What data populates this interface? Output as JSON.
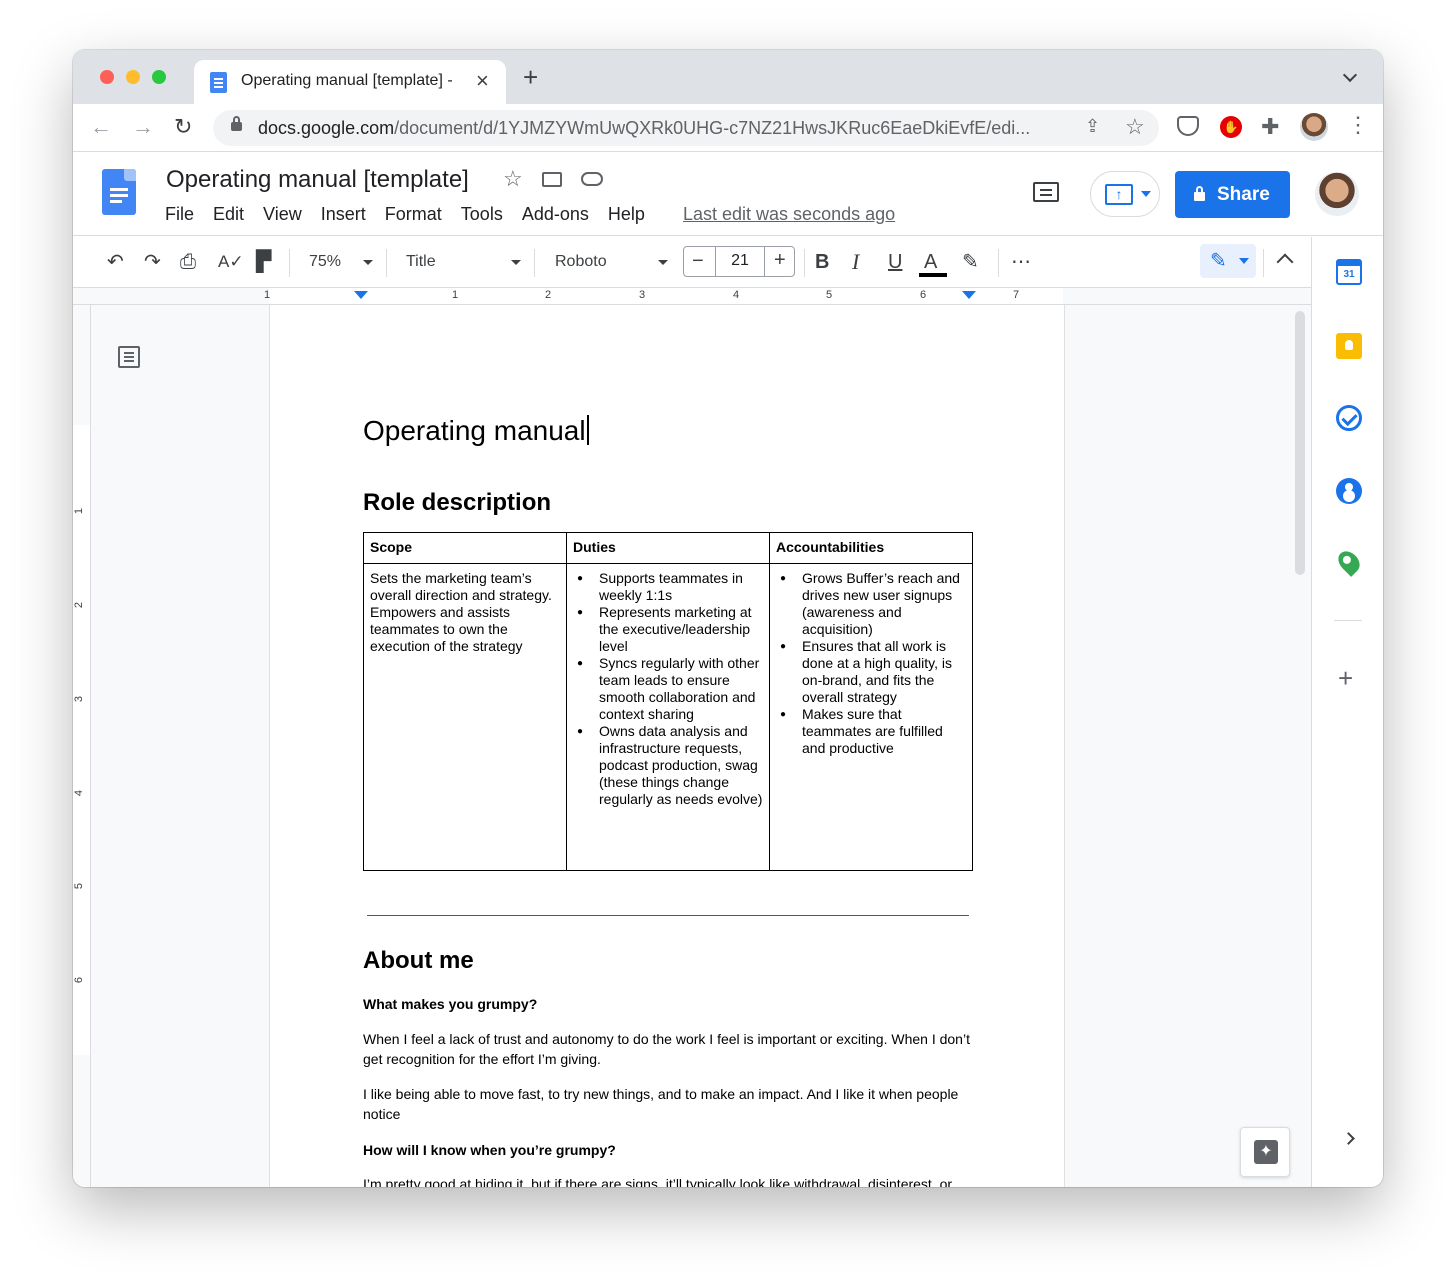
{
  "browser": {
    "tab_title": "Operating manual [template] -",
    "new_tab": "+",
    "url_host": "docs.google.com",
    "url_path": "/document/d/1YJMZYWmUwQXRk0UHG-c7NZ21HwsJKRuc6EaeDkiEvfE/edi..."
  },
  "docs": {
    "title": "Operating manual [template]",
    "menu": [
      "File",
      "Edit",
      "View",
      "Insert",
      "Format",
      "Tools",
      "Add-ons",
      "Help"
    ],
    "last_edit": "Last edit was seconds ago",
    "share_label": "Share"
  },
  "toolbar": {
    "zoom": "75%",
    "style": "Title",
    "font": "Roboto",
    "font_size": "21",
    "bold": "B",
    "italic": "I",
    "underline": "U",
    "text_color": "A"
  },
  "ruler": {
    "horizontal_labels": [
      "1",
      "1",
      "2",
      "3",
      "4",
      "5",
      "6",
      "7"
    ],
    "vertical_labels": [
      "1",
      "2",
      "3",
      "4",
      "5",
      "6"
    ]
  },
  "document": {
    "title": "Operating manual",
    "role_heading": "Role description",
    "table": {
      "headers": [
        "Scope",
        "Duties",
        "Accountabilities"
      ],
      "scope": "Sets the marketing team’s overall direction and strategy. Empowers and assists teammates to own the execution of the strategy",
      "duties": [
        "Supports teammates in weekly 1:1s",
        "Represents marketing at the executive/leadership level",
        "Syncs regularly with other team leads to ensure smooth collaboration and context sharing",
        "Owns data analysis and infrastructure requests, podcast production, swag (these things change regularly as needs evolve)"
      ],
      "accountabilities": [
        "Grows Buffer’s reach and drives new user signups (awareness and acquisition)",
        "Ensures that all work is done at a high quality, is on-brand, and fits the overall strategy",
        "Makes sure that teammates are fulfilled and productive"
      ]
    },
    "about_heading": "About me",
    "q1": "What makes you grumpy?",
    "p1": "When I feel a lack of trust and autonomy to do the work I feel is important or exciting. When I don’t get recognition for the effort I’m giving.",
    "p2": "I like being able to move fast, to try new things, and to make an impact. And I like it when people notice",
    "q2": "How will I know when you’re grumpy?",
    "p3": "I’m pretty good at hiding it, but if there are signs, it’ll typically look like withdrawal, disinterest, or"
  },
  "sidepanel": {
    "calendar_day": "31"
  },
  "colors": {
    "accent": "#1a73e8",
    "docs_blue": "#4285f4"
  }
}
